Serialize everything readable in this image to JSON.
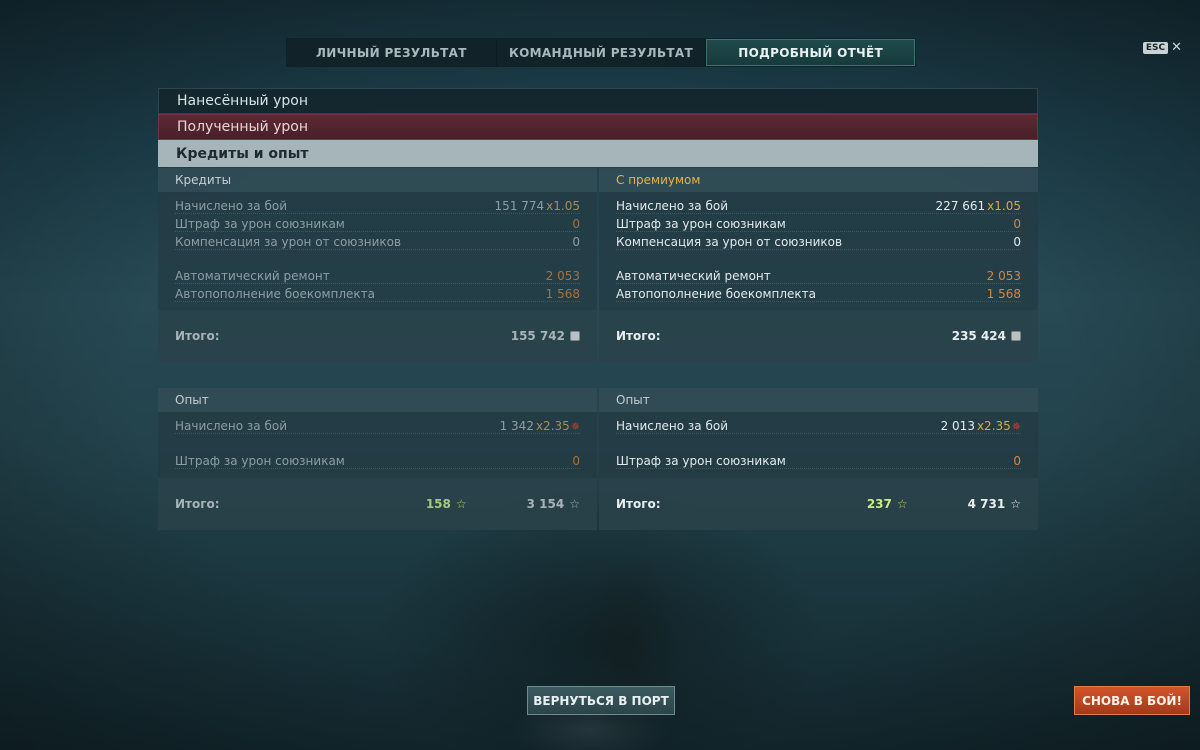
{
  "tabs": [
    {
      "label": "ЛИЧНЫЙ РЕЗУЛЬТАТ",
      "active": false
    },
    {
      "label": "КОМАНДНЫЙ РЕЗУЛЬТАТ",
      "active": false
    },
    {
      "label": "ПОДРОБНЫЙ ОТЧЁТ",
      "active": true
    }
  ],
  "esc": {
    "key": "ESC",
    "close": "✕"
  },
  "sections": {
    "damage_dealt": "Нанесённый урон",
    "damage_received": "Полученный урон",
    "credits_xp": "Кредиты и опыт"
  },
  "credits": {
    "base": {
      "header": "Кредиты",
      "earned_label": "Начислено за бой",
      "earned_value": "151 774",
      "earned_mult": "x1.05",
      "penalty_label": "Штраф за урон союзникам",
      "penalty_value": "0",
      "compensation_label": "Компенсация за урон от союзников",
      "compensation_value": "0",
      "repair_label": "Автоматический ремонт",
      "repair_value": "2 053",
      "resupply_label": "Автопополнение боекомплекта",
      "resupply_value": "1 568",
      "total_label": "Итого:",
      "total_value": "155 742"
    },
    "premium": {
      "header": "С премиумом",
      "earned_label": "Начислено за бой",
      "earned_value": "227 661",
      "earned_mult": "x1.05",
      "penalty_label": "Штраф за урон союзникам",
      "penalty_value": "0",
      "compensation_label": "Компенсация за урон от союзников",
      "compensation_value": "0",
      "repair_label": "Автоматический ремонт",
      "repair_value": "2 053",
      "resupply_label": "Автопополнение боекомплекта",
      "resupply_value": "1 568",
      "total_label": "Итого:",
      "total_value": "235 424"
    }
  },
  "experience": {
    "base": {
      "header": "Опыт",
      "earned_label": "Начислено за бой",
      "earned_value": "1 342",
      "earned_mult": "x2.35",
      "penalty_label": "Штраф за урон союзникам",
      "penalty_value": "0",
      "total_label": "Итого:",
      "free_xp": "158",
      "total_xp": "3 154"
    },
    "premium": {
      "header": "Опыт",
      "earned_label": "Начислено за бой",
      "earned_value": "2 013",
      "earned_mult": "x2.35",
      "penalty_label": "Штраф за урон союзникам",
      "penalty_value": "0",
      "total_label": "Итого:",
      "free_xp": "237",
      "total_xp": "4 731"
    }
  },
  "buttons": {
    "return_port": "ВЕРНУТЬСЯ В ПОРТ",
    "battle_again": "СНОВА В БОЙ!"
  },
  "icons": {
    "star": "☆",
    "elite_xp": "✵",
    "credits": "credits-icon"
  },
  "colors": {
    "accent_orange": "#d9843a",
    "premium_gold": "#e8b34e",
    "battle_button": "#c24a22"
  }
}
